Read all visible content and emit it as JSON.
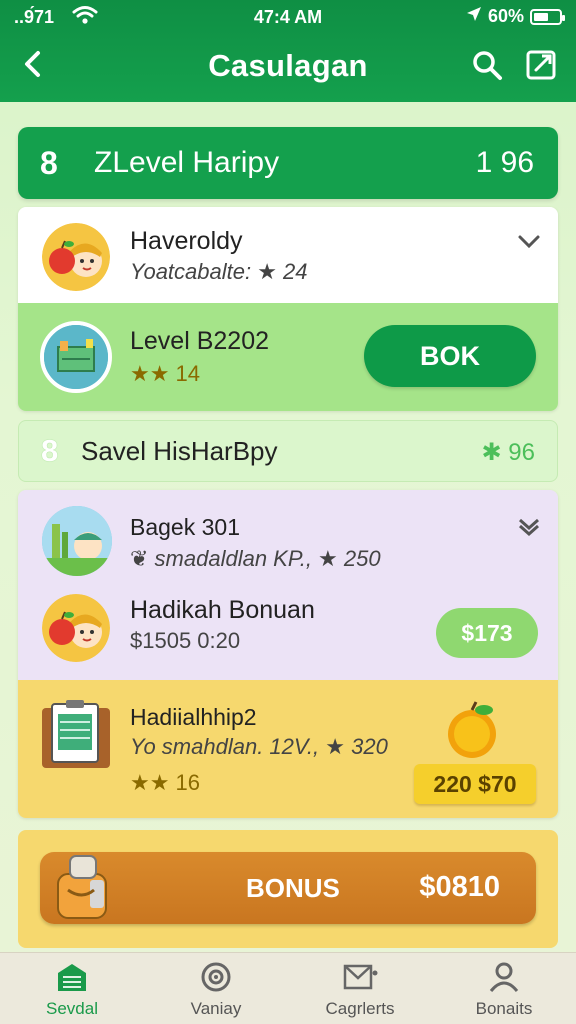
{
  "status": {
    "carrier": "..9́71",
    "time": "47:4 AM",
    "battery": "60%",
    "battery_level": 0.6
  },
  "header": {
    "title": "Casulagan"
  },
  "banner": {
    "number": "8",
    "label": "ZLevel Haripy",
    "score": "1 96"
  },
  "card1": {
    "row1": {
      "title": "Haveroldy",
      "subtitle": "Yoatcabalte: ★ 24"
    },
    "row2": {
      "title": "Level B2202",
      "subtitle": "★★ 14",
      "button": "BOK"
    }
  },
  "bar2": {
    "number": "8",
    "label": "Savel HisHarBpy",
    "score": "✱ 96"
  },
  "card2": {
    "row1": {
      "title": "Bagek 301",
      "subtitle": "❦ smadaldlan ΚΡ., ★ 250"
    },
    "row2": {
      "title": "Hadikah Bonuan",
      "subtitle": "$1505 0:20",
      "price": "$173"
    },
    "row3": {
      "title": "Hadiialhhip2",
      "subtitle": "Yo smahdlan. 12V., ★ 320",
      "stars": "★★ 16",
      "price": "220 $70"
    }
  },
  "bonus": {
    "label": "BONUS",
    "amount": "$0810"
  },
  "nav": [
    {
      "label": "Sevdal",
      "icon": "shop-icon",
      "active": true
    },
    {
      "label": "Vaniay",
      "icon": "target-icon",
      "active": false
    },
    {
      "label": "Cagrlerts",
      "icon": "mail-icon",
      "active": false
    },
    {
      "label": "Bonaits",
      "icon": "profile-icon",
      "active": false
    }
  ],
  "colors": {
    "primary_green": "#14a04d",
    "light_green": "#a5e489",
    "purple_bg": "#ece3f6",
    "yellow_bg": "#f6d86e",
    "bonus_orange": "#d98a2c"
  }
}
